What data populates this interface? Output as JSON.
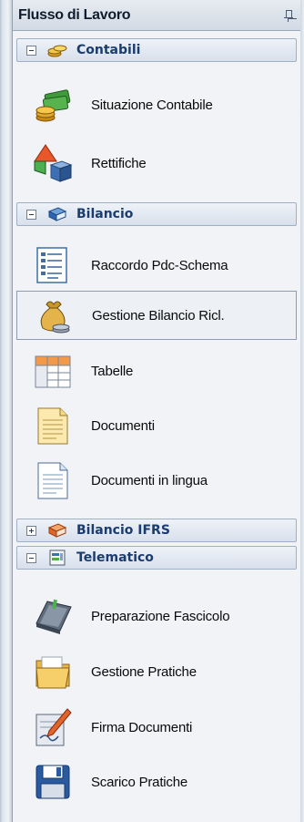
{
  "panel": {
    "title": "Flusso di Lavoro"
  },
  "groups": [
    {
      "label": "Contabili",
      "expanded": true,
      "icon": "coins-icon",
      "items": [
        {
          "label": "Situazione Contabile",
          "icon": "money-stack-icon"
        },
        {
          "label": "Rettifiche",
          "icon": "shapes-icon"
        }
      ]
    },
    {
      "label": "Bilancio",
      "expanded": true,
      "icon": "book-icon",
      "items": [
        {
          "label": "Raccordo Pdc-Schema",
          "icon": "list-document-icon"
        },
        {
          "label": "Gestione Bilancio Ricl.",
          "icon": "money-bag-icon",
          "selected": true
        },
        {
          "label": "Tabelle",
          "icon": "table-icon"
        },
        {
          "label": "Documenti",
          "icon": "notepad-icon"
        },
        {
          "label": "Documenti in lingua",
          "icon": "document-icon"
        }
      ]
    },
    {
      "label": "Bilancio IFRS",
      "expanded": false,
      "icon": "ifrs-book-icon",
      "items": []
    },
    {
      "label": "Telematico",
      "expanded": true,
      "icon": "telematic-icon",
      "items": [
        {
          "label": "Preparazione Fascicolo",
          "icon": "binder-icon"
        },
        {
          "label": "Gestione Pratiche",
          "icon": "folder-icon"
        },
        {
          "label": "Firma Documenti",
          "icon": "sign-document-icon"
        },
        {
          "label": "Scarico Pratiche",
          "icon": "floppy-disk-icon"
        }
      ]
    }
  ]
}
